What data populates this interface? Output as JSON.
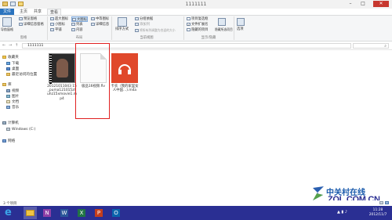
{
  "window": {
    "title": "1111111",
    "controls": {
      "minimize": "–",
      "maximize": "□",
      "close": "✕"
    }
  },
  "tabs": {
    "file": "文件",
    "home": "主页",
    "share": "共享",
    "view": "查看"
  },
  "ribbon": {
    "pane_group": {
      "nav_pane": "导航窗格",
      "preview": "预览窗格",
      "details": "详细信息窗格",
      "label": "窗格"
    },
    "layout_group": {
      "items": [
        "超大图标",
        "大图标",
        "中等图标",
        "小图标",
        "列表",
        "详细信息",
        "平铺",
        "内容"
      ],
      "selected": "大图标",
      "label": "布局"
    },
    "view_group": {
      "sort": "排序方式",
      "group_by": "分组依据",
      "add_column": "添加列",
      "fit_columns": "将所有列调整为合适的大小",
      "label": "当前视图"
    },
    "showhide_group": {
      "checkbox": "项目复选框",
      "extensions": "文件扩展名",
      "hidden": "隐藏的项目",
      "hide_selected": "隐藏所选项目",
      "label": "显示/隐藏"
    },
    "options": "选项"
  },
  "address": {
    "path": "1111111",
    "nav_back": "←",
    "nav_forward": "→",
    "nav_up": "↑"
  },
  "nav": {
    "favorites": "收藏夹",
    "favorites_items": [
      "下载",
      "桌面",
      "最近访问的位置"
    ],
    "libraries": "库",
    "libraries_items": [
      "视频",
      "图片",
      "文档",
      "音乐"
    ],
    "computer": "计算机",
    "computer_items": [
      "Windows (C:)"
    ],
    "network": "网络"
  },
  "files": [
    {
      "name": "20121011043 15_puma121015zhuhz15xmovie1.mp4",
      "type": "video"
    },
    {
      "name": "极品16视频.flv",
      "type": "blank"
    },
    {
      "name": "卡农（我的家里女人中国...).m4a",
      "type": "music"
    }
  ],
  "status": {
    "count": "3 个项目"
  },
  "taskbar": {
    "time": "11:28",
    "date": "2012/11/7",
    "apps": [
      "ie-icon",
      "explorer-icon",
      "onenote-icon",
      "word-icon",
      "excel-icon",
      "powerpoint-icon",
      "outlook-icon"
    ]
  },
  "watermark": {
    "brand": "中关村在线",
    "url": "ZOL.COM.CN"
  },
  "colors": {
    "taskbar": "#2a2f93",
    "file_tab": "#2a73be",
    "music_tile": "#e0482b",
    "highlight": "#e02020"
  }
}
